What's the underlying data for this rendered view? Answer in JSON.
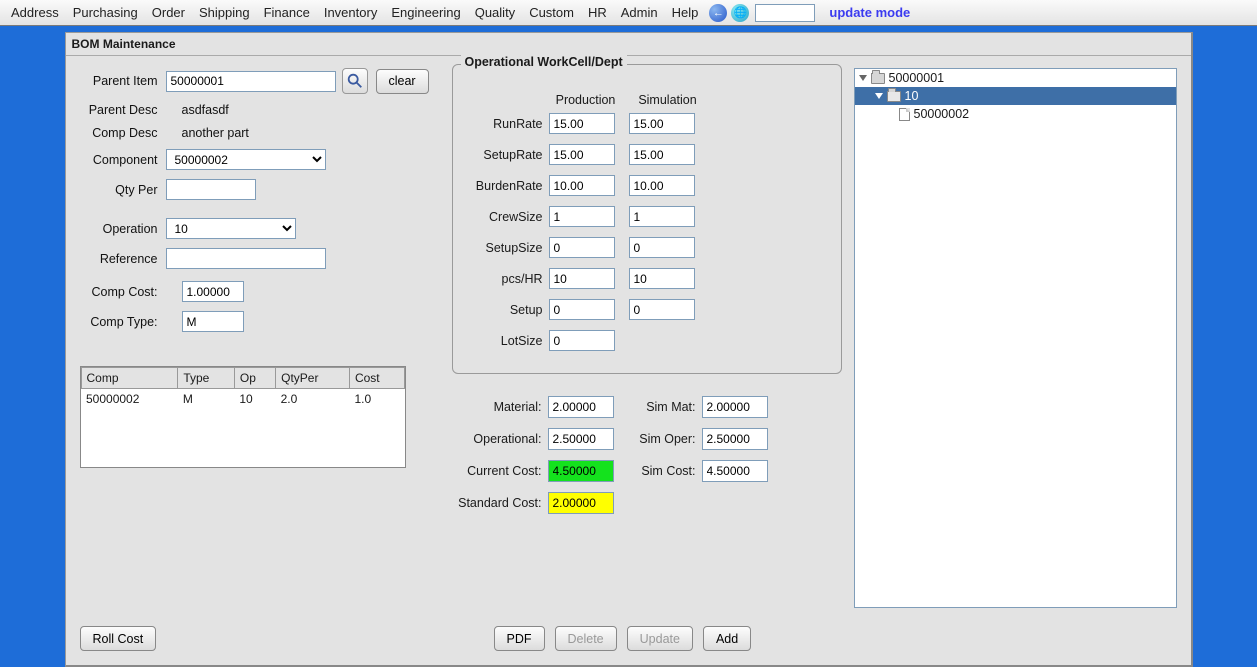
{
  "menubar": {
    "items": [
      "Address",
      "Purchasing",
      "Order",
      "Shipping",
      "Finance",
      "Inventory",
      "Engineering",
      "Quality",
      "Custom",
      "HR",
      "Admin",
      "Help"
    ],
    "mode_label": "update mode"
  },
  "panel": {
    "title": "BOM Maintenance"
  },
  "form": {
    "labels": {
      "parent_item": "Parent Item",
      "parent_desc": "Parent Desc",
      "comp_desc": "Comp Desc",
      "component": "Component",
      "qty_per": "Qty Per",
      "operation": "Operation",
      "reference": "Reference",
      "comp_cost": "Comp Cost:",
      "comp_type": "Comp Type:"
    },
    "clear": "clear",
    "parent_item": "50000001",
    "parent_desc": "asdfasdf",
    "comp_desc": "another part",
    "component": "50000002",
    "qty_per": "",
    "operation": "10",
    "reference": "",
    "comp_cost": "1.00000",
    "comp_type": "M"
  },
  "table": {
    "headers": [
      "Comp",
      "Type",
      "Op",
      "QtyPer",
      "Cost"
    ],
    "rows": [
      {
        "comp": "50000002",
        "type": "M",
        "op": "10",
        "qtyper": "2.0",
        "cost": "1.0"
      }
    ]
  },
  "workcell": {
    "legend": "Operational WorkCell/Dept",
    "col_headers": [
      "Production",
      "Simulation"
    ],
    "rows": {
      "runrate": {
        "label": "RunRate",
        "prod": "15.00",
        "sim": "15.00"
      },
      "setuprate": {
        "label": "SetupRate",
        "prod": "15.00",
        "sim": "15.00"
      },
      "burdenrate": {
        "label": "BurdenRate",
        "prod": "10.00",
        "sim": "10.00"
      },
      "crewsize": {
        "label": "CrewSize",
        "prod": "1",
        "sim": "1"
      },
      "setupsize": {
        "label": "SetupSize",
        "prod": "0",
        "sim": "0"
      },
      "pcshr": {
        "label": "pcs/HR",
        "prod": "10",
        "sim": "10"
      },
      "setup": {
        "label": "Setup",
        "prod": "0",
        "sim": "0"
      },
      "lotsize": {
        "label": "LotSize",
        "prod": "0"
      }
    }
  },
  "costs": {
    "labels": {
      "material": "Material:",
      "operational": "Operational:",
      "current": "Current Cost:",
      "standard": "Standard Cost:",
      "sim_mat": "Sim Mat:",
      "sim_oper": "Sim Oper:",
      "sim_cost": "Sim Cost:"
    },
    "material": "2.00000",
    "operational": "2.50000",
    "current": "4.50000",
    "standard": "2.00000",
    "sim_mat": "2.00000",
    "sim_oper": "2.50000",
    "sim_cost": "4.50000"
  },
  "buttons": {
    "roll_cost": "Roll Cost",
    "pdf": "PDF",
    "delete": "Delete",
    "update": "Update",
    "add": "Add"
  },
  "tree": {
    "root": "50000001",
    "child": "10",
    "leaf": "50000002"
  }
}
